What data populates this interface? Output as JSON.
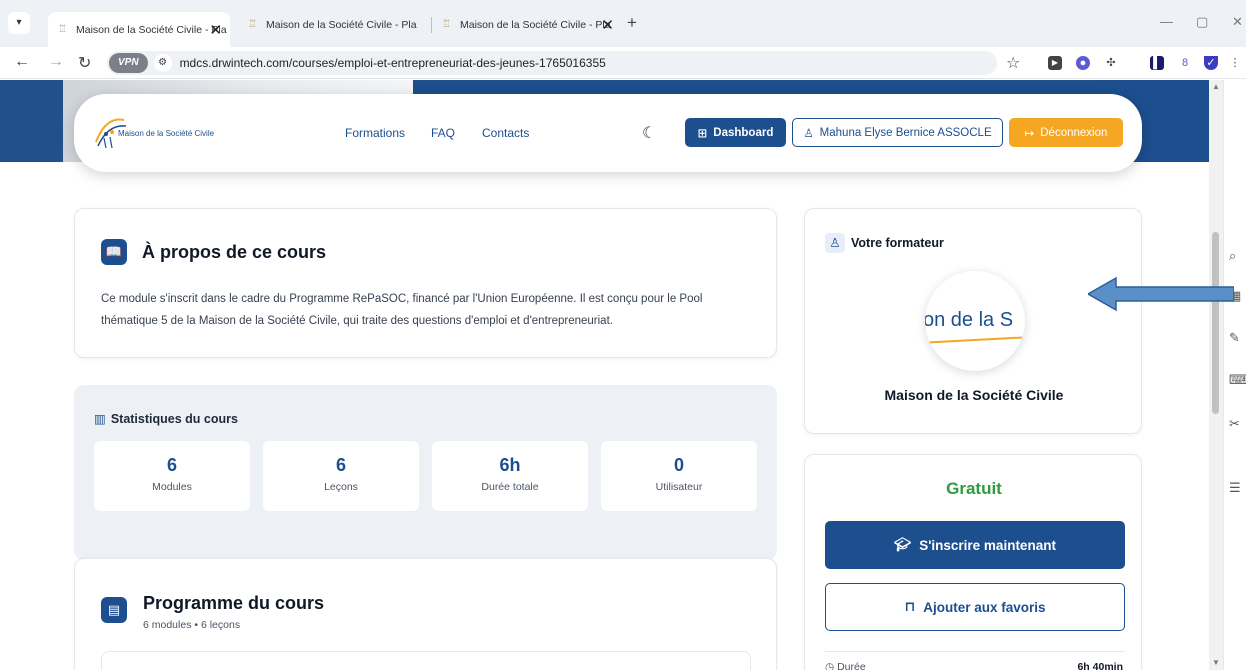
{
  "browser": {
    "tabs": [
      {
        "title": "Maison de la Société Civile - Pla",
        "active": true
      },
      {
        "title": "Maison de la Société Civile - Pla",
        "active": false
      },
      {
        "title": "Maison de la Société Civile - Pla",
        "active": false
      }
    ],
    "url": "mdcs.drwintech.com/courses/emploi-et-entrepreneuriat-des-jeunes-1765016355",
    "vpn_label": "VPN"
  },
  "header": {
    "logo_text": "Maison de la Société Civile",
    "nav": [
      "Formations",
      "FAQ",
      "Contacts"
    ],
    "dashboard_label": "Dashboard",
    "user_label": "Mahuna Elyse Bernice ASSOCLE",
    "logout_label": "Déconnexion"
  },
  "about": {
    "title": "À propos de ce cours",
    "description": "Ce module s'inscrit dans le cadre du Programme RePaSOC, financé par l'Union Européenne. Il est conçu pour le Pool thématique 5 de la Maison de la Société Civile, qui traite des questions d'emploi et d'entrepreneuriat."
  },
  "stats": {
    "title": "Statistiques du cours",
    "items": [
      {
        "value": "6",
        "label": "Modules"
      },
      {
        "value": "6",
        "label": "Leçons"
      },
      {
        "value": "6h",
        "label": "Durée totale"
      },
      {
        "value": "0",
        "label": "Utilisateur"
      }
    ]
  },
  "program": {
    "title": "Programme du cours",
    "subtitle": "6 modules • 6 leçons"
  },
  "trainer": {
    "heading": "Votre formateur",
    "avatar_text": "on de la S",
    "name": "Maison de la Société Civile"
  },
  "pricing": {
    "price": "Gratuit",
    "enroll_label": "S'inscrire maintenant",
    "favorite_label": "Ajouter aux favoris",
    "duration_label": "Durée",
    "duration_value": "6h 40min"
  },
  "colors": {
    "primary": "#1d4e8e",
    "accent": "#f5a623",
    "success": "#2e9b3e"
  }
}
